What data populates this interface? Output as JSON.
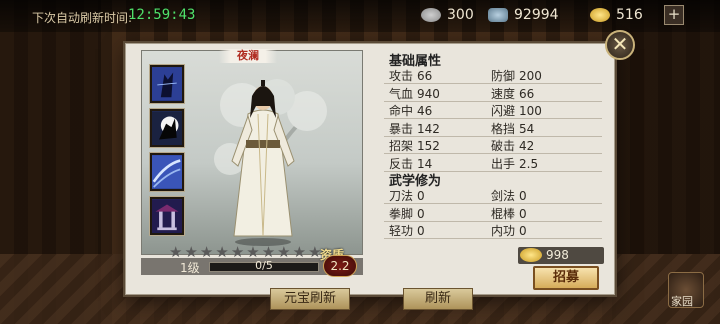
{
  "header": {
    "refresh_label": "下次自动刷新时间:",
    "refresh_time": "12:59:43",
    "resources": [
      {
        "icon": "silver-coin-icon",
        "value": "300"
      },
      {
        "icon": "ingot-icon",
        "value": "92994"
      },
      {
        "icon": "gold-ingot-icon",
        "value": "516"
      }
    ],
    "plus_label": "+"
  },
  "dialog": {
    "close_label": "✕",
    "hero": {
      "name": "夜澜",
      "level_label": "1级",
      "exp_text": "0/5",
      "exp_progress": 0,
      "stars_total": 10,
      "quality_label": "资质",
      "quality_value": "2.2"
    },
    "skills": [
      {
        "icon": "sword-stance-skill-icon"
      },
      {
        "icon": "shadow-leap-skill-icon"
      },
      {
        "icon": "wind-slash-skill-icon"
      },
      {
        "icon": "pavilion-skill-icon"
      }
    ],
    "basic_title": "基础属性",
    "basic_stats": [
      {
        "label": "攻击",
        "value": "66"
      },
      {
        "label": "防御",
        "value": "200"
      },
      {
        "label": "气血",
        "value": "940"
      },
      {
        "label": "速度",
        "value": "66"
      },
      {
        "label": "命中",
        "value": "46"
      },
      {
        "label": "闪避",
        "value": "100"
      },
      {
        "label": "暴击",
        "value": "142"
      },
      {
        "label": "格挡",
        "value": "54"
      },
      {
        "label": "招架",
        "value": "152"
      },
      {
        "label": "破击",
        "value": "42"
      },
      {
        "label": "反击",
        "value": "14"
      },
      {
        "label": "出手",
        "value": "2.5"
      }
    ],
    "martial_title": "武学修为",
    "martial_stats": [
      {
        "label": "刀法",
        "value": "0"
      },
      {
        "label": "剑法",
        "value": "0"
      },
      {
        "label": "拳脚",
        "value": "0"
      },
      {
        "label": "棍棒",
        "value": "0"
      },
      {
        "label": "轻功",
        "value": "0"
      },
      {
        "label": "内功",
        "value": "0"
      }
    ],
    "price": "998",
    "recruit_label": "招募"
  },
  "footer": {
    "yuanbao_refresh_label": "元宝刷新",
    "refresh_label": "刷新",
    "home_label": "家园"
  },
  "colors": {
    "timer": "#4fe06a",
    "hero_name": "#b02d22",
    "recruit_button": "#d6ac5a"
  }
}
